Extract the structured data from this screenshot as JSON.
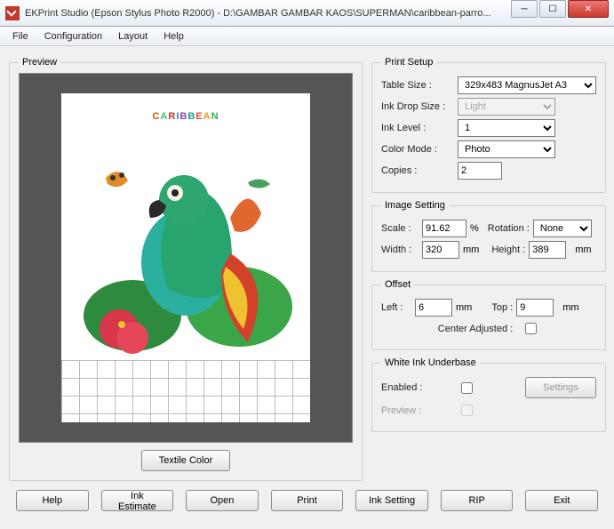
{
  "window": {
    "title": "EKPrint Studio (Epson Stylus Photo R2000) - D:\\GAMBAR GAMBAR KAOS\\SUPERMAN\\caribbean-parro..."
  },
  "menu": {
    "file": "File",
    "config": "Configuration",
    "layout": "Layout",
    "help": "Help"
  },
  "preview": {
    "legend": "Preview",
    "textile_color_btn": "Textile Color",
    "art_text": "CARIBBEAN"
  },
  "print_setup": {
    "legend": "Print Setup",
    "table_size_label": "Table Size :",
    "table_size_value": "329x483 MagnusJet A3",
    "ink_drop_label": "Ink Drop Size :",
    "ink_drop_value": "Light",
    "ink_level_label": "Ink Level :",
    "ink_level_value": "1",
    "color_mode_label": "Color Mode :",
    "color_mode_value": "Photo",
    "copies_label": "Copies :",
    "copies_value": "2"
  },
  "image_setting": {
    "legend": "Image Setting",
    "scale_label": "Scale :",
    "scale_value": "91.62",
    "percent": "%",
    "rotation_label": "Rotation :",
    "rotation_value": "None",
    "width_label": "Width :",
    "width_value": "320",
    "height_label": "Height :",
    "height_value": "389",
    "mm": "mm"
  },
  "offset": {
    "legend": "Offset",
    "left_label": "Left :",
    "left_value": "6",
    "top_label": "Top :",
    "top_value": "9",
    "mm": "mm",
    "center_label": "Center Adjusted :"
  },
  "white_ink": {
    "legend": "White Ink Underbase",
    "enabled_label": "Enabled :",
    "preview_label": "Preview :",
    "settings_btn": "Settings"
  },
  "buttons": {
    "help": "Help",
    "ink_estimate": "Ink Estimate",
    "open": "Open",
    "print": "Print",
    "ink_setting": "Ink Setting",
    "rip": "RIP",
    "exit": "Exit"
  }
}
